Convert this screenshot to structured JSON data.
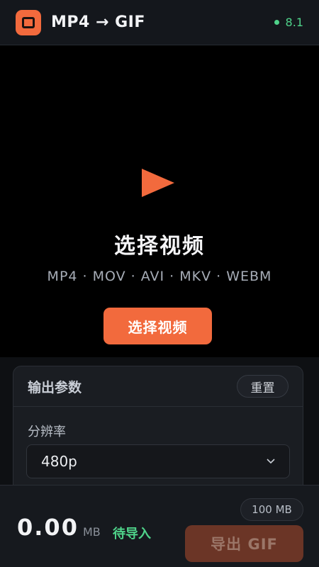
{
  "header": {
    "title": "MP4 → GIF",
    "version": "8.1",
    "logo_icon": "square-frame-icon",
    "accent_color": "#f26a3d",
    "status_color": "#4fd38a"
  },
  "drop_area": {
    "icon": "play-icon",
    "title": "选择视频",
    "formats": "MP4 · MOV · AVI · MKV · WEBM",
    "button_label": "选择视频"
  },
  "output_panel": {
    "title": "输出参数",
    "reset_label": "重置",
    "resolution_label": "分辨率",
    "resolution_value": "480p"
  },
  "bottom_bar": {
    "limit": "100 MB",
    "size": "0.00",
    "unit": "MB",
    "status": "待导入",
    "export_label": "导出 GIF"
  }
}
